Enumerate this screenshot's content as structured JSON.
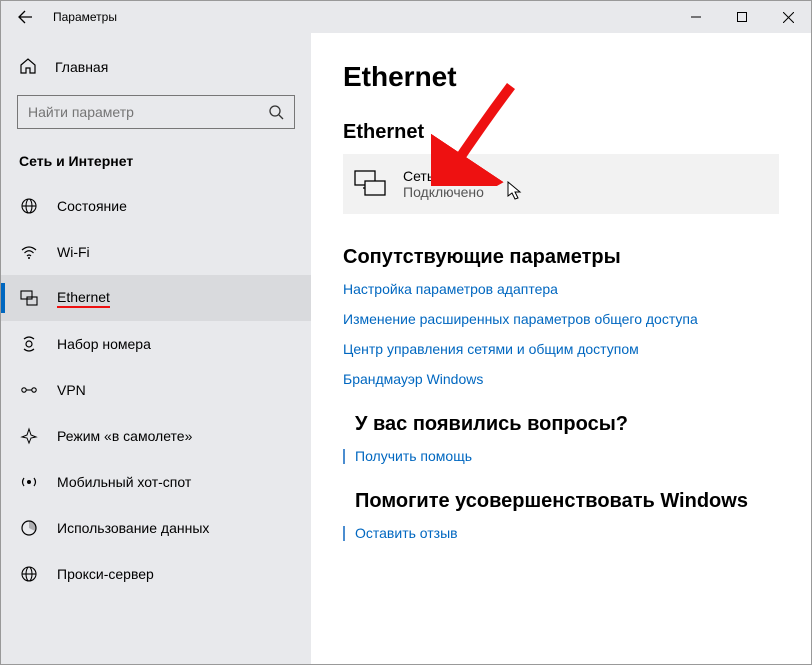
{
  "window": {
    "title": "Параметры"
  },
  "sidebar": {
    "home": "Главная",
    "search_placeholder": "Найти параметр",
    "category": "Сеть и Интернет",
    "items": [
      {
        "label": "Состояние"
      },
      {
        "label": "Wi-Fi"
      },
      {
        "label": "Ethernet"
      },
      {
        "label": "Набор номера"
      },
      {
        "label": "VPN"
      },
      {
        "label": "Режим «в самолете»"
      },
      {
        "label": "Мобильный хот-спот"
      },
      {
        "label": "Использование данных"
      },
      {
        "label": "Прокси-сервер"
      }
    ]
  },
  "content": {
    "title": "Ethernet",
    "subtitle": "Ethernet",
    "network": {
      "name": "Сеть",
      "status": "Подключено"
    },
    "related": {
      "heading": "Сопутствующие параметры",
      "links": [
        "Настройка параметров адаптера",
        "Изменение расширенных параметров общего доступа",
        "Центр управления сетями и общим доступом",
        "Брандмауэр Windows"
      ]
    },
    "help": {
      "heading": "У вас появились вопросы?",
      "link": "Получить помощь"
    },
    "improve": {
      "heading": "Помогите усовершенствовать Windows",
      "link": "Оставить отзыв"
    }
  }
}
